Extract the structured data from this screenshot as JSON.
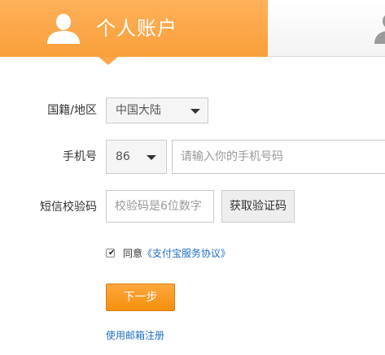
{
  "tabs": {
    "personal": {
      "label": "个人账户",
      "icon": "user-icon"
    },
    "enterprise": {
      "icon": "user-icon"
    }
  },
  "form": {
    "region": {
      "label": "国籍/地区",
      "value": "中国大陆",
      "icon": "caret-down-icon"
    },
    "phone": {
      "label": "手机号",
      "country_code": "86",
      "icon": "caret-down-icon",
      "placeholder": "请输入你的手机号码"
    },
    "sms_code": {
      "label": "短信校验码",
      "placeholder": "校验码是6位数字",
      "get_code_label": "获取验证码"
    },
    "agreement": {
      "checked": true,
      "text": "同意",
      "link": "《支付宝服务协议》"
    },
    "next_label": "下一步",
    "email_register_label": "使用邮箱注册"
  },
  "colors": {
    "accent": "#f99f3a",
    "link": "#1f6fc4",
    "primary_button": "#f4900e"
  }
}
